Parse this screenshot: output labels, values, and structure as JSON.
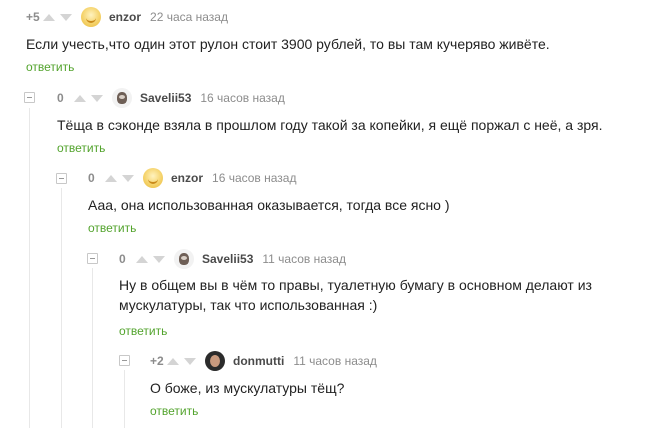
{
  "colors": {
    "reply_link": "#52a32c",
    "meta_text": "#8c8c8c",
    "username": "#4a4a4a",
    "thread_line": "#e8e8e8"
  },
  "comments": [
    {
      "rating": "+5",
      "username": "enzor",
      "time": "22 часа назад",
      "avatar_icon": "smiling-sun-avatar",
      "text_lines": [
        "Если учесть,что один этот рулон стоит 3900 рублей, то вы там кучеряво живёте."
      ],
      "reply": "ответить"
    },
    {
      "rating": "0",
      "username": "Savelii53",
      "time": "16 часов назад",
      "avatar_icon": "raccoon-avatar",
      "text_lines": [
        "Тёща в сэконде взяла в прошлом году такой за копейки, я ещё поржал с неё, а зря."
      ],
      "reply": "ответить"
    },
    {
      "rating": "0",
      "username": "enzor",
      "time": "16 часов назад",
      "avatar_icon": "smiling-sun-avatar",
      "text_lines": [
        "Ааа, она использованная оказывается, тогда все ясно )"
      ],
      "reply": "ответить"
    },
    {
      "rating": "0",
      "username": "Savelii53",
      "time": "11 часов назад",
      "avatar_icon": "raccoon-avatar",
      "text_lines": [
        "Ну в общем вы в чём то правы, туалетную бумагу в основном делают из",
        "мускулатуры, так что использованная :)"
      ],
      "reply": "ответить"
    },
    {
      "rating": "+2",
      "username": "donmutti",
      "time": "11 часов назад",
      "avatar_icon": "person-photo-avatar",
      "text_lines": [
        "О боже, из мускулатуры тёщ?"
      ],
      "reply": "ответить"
    }
  ]
}
